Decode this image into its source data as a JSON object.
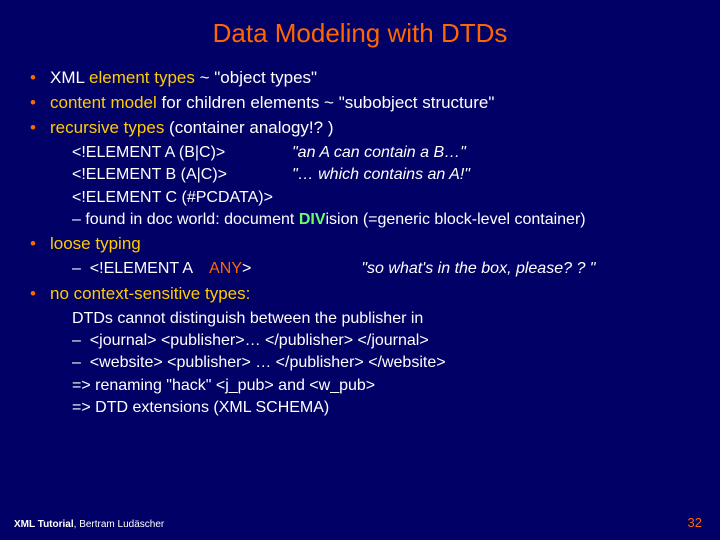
{
  "title": "Data Modeling with DTDs",
  "b1": {
    "pre": "XML ",
    "hl": "element types",
    "post": " ~ \"object types\""
  },
  "b2": {
    "hl": "content model",
    "post": " for children elements ~ \"subobject structure\""
  },
  "b3": {
    "hl": "recursive types",
    "post": " (container analogy!? )"
  },
  "code": {
    "l1a": "<!ELEMENT A (B|C)>",
    "l1b": "\"an A can contain a B…\"",
    "l2a": "<!ELEMENT B (A|C)>",
    "l2b": "\"… which contains an A!\"",
    "l3": "<!ELEMENT C (#PCDATA)>",
    "dash_pre": "–  found in doc world: document ",
    "div": "DIV",
    "dash_post": "ision (=generic block-level container)"
  },
  "b4": "loose typing",
  "loose": {
    "pre": "–  <!ELEMENT A    ",
    "any": "ANY",
    "post": ">",
    "comment": "\"so what's in the box, please? ? \""
  },
  "b5": "no context-sensitive types:",
  "ctx": {
    "l1": "DTDs cannot distinguish between the publisher in",
    "l2": "–  <journal> <publisher>… </publisher> </journal>",
    "l3": "–  <website> <publisher> … </publisher> </website>",
    "l4": "=> renaming \"hack\" <j_pub> and <w_pub>",
    "l5": "=> DTD extensions (XML SCHEMA)"
  },
  "footer_a": "XML Tutorial",
  "footer_b": ", Bertram Ludäscher",
  "page": "32"
}
